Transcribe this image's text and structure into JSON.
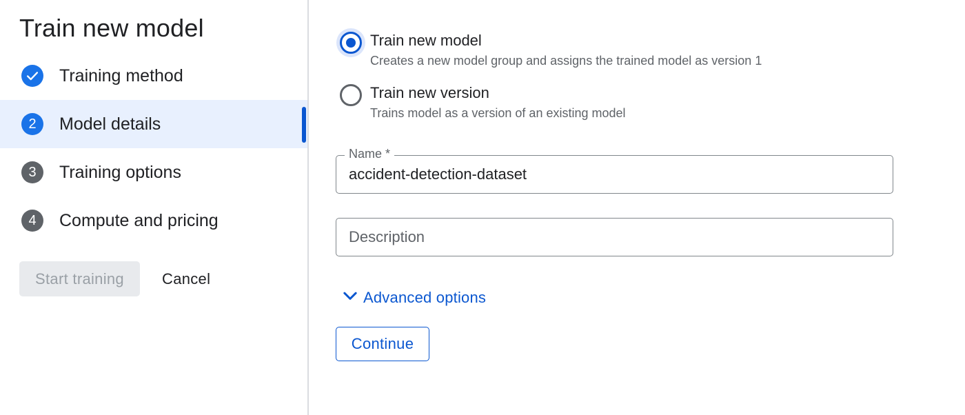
{
  "sidebar": {
    "title": "Train new model",
    "steps": [
      {
        "badge": "",
        "label": "Training method",
        "state": "completed"
      },
      {
        "badge": "2",
        "label": "Model details",
        "state": "active"
      },
      {
        "badge": "3",
        "label": "Training options",
        "state": "pending"
      },
      {
        "badge": "4",
        "label": "Compute and pricing",
        "state": "pending"
      }
    ],
    "start_training_label": "Start training",
    "start_training_enabled": false,
    "cancel_label": "Cancel"
  },
  "main": {
    "radio_options": [
      {
        "title": "Train new model",
        "description": "Creates a new model group and assigns the trained model as version 1",
        "selected": true
      },
      {
        "title": "Train new version",
        "description": "Trains model as a version of an existing model",
        "selected": false
      }
    ],
    "name_field": {
      "label": "Name *",
      "value": "accident-detection-dataset"
    },
    "description_field": {
      "placeholder": "Description",
      "value": ""
    },
    "advanced_options_label": "Advanced options",
    "continue_label": "Continue"
  },
  "colors": {
    "accent": "#0b57d0",
    "step_blue": "#1a73e8",
    "active_step_bg": "#e8f0fe",
    "pending_badge": "#5f6368",
    "disabled_button_bg": "#e8eaed"
  },
  "icons": {
    "completed_step": "check-icon",
    "advanced_toggle": "chevron-down-icon"
  }
}
